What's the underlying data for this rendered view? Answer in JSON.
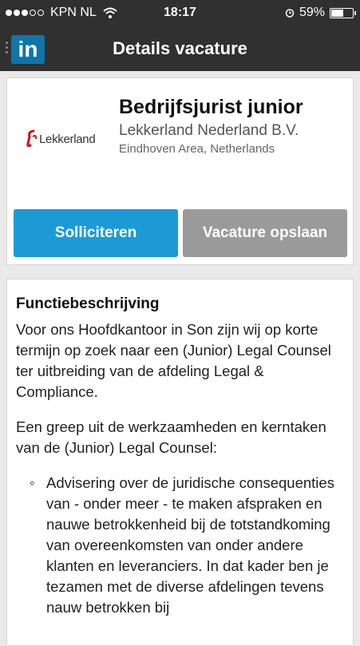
{
  "status_bar": {
    "carrier": "KPN NL",
    "time": "18:17",
    "battery": "59%",
    "battery_level": 0.59
  },
  "nav": {
    "title": "Details vacature",
    "logo_text": "in"
  },
  "job": {
    "logo_text": "Lekkerland",
    "title": "Bedrijfsjurist junior",
    "company": "Lekkerland Nederland B.V.",
    "location": "Eindhoven Area, Netherlands",
    "apply_label": "Solliciteren",
    "save_label": "Vacature opslaan"
  },
  "description": {
    "heading": "Functiebeschrijving",
    "paragraphs": [
      "Voor ons Hoofdkantoor in Son zijn wij op korte termijn op zoek naar een (Junior) Legal Counsel ter uitbreiding van de afdeling Legal & Compliance.",
      "Een greep uit de werkzaamheden en kerntaken van de (Junior) Legal Counsel:"
    ],
    "bullets": [
      "Advisering over de juridische consequenties van - onder meer - te maken afspraken en nauwe betrokkenheid bij de totstandkoming van overeenkomsten van onder andere klanten en leveranciers. In dat kader ben je tezamen met de diverse afdelingen tevens nauw betrokken bij"
    ],
    "bullet_mark": "◦"
  },
  "colors": {
    "bar": "#303030",
    "linkedin_blue": "#0e76a8",
    "apply": "#1c9ad6",
    "save": "#9a9a9a",
    "lekkerland_red": "#d0101b"
  }
}
